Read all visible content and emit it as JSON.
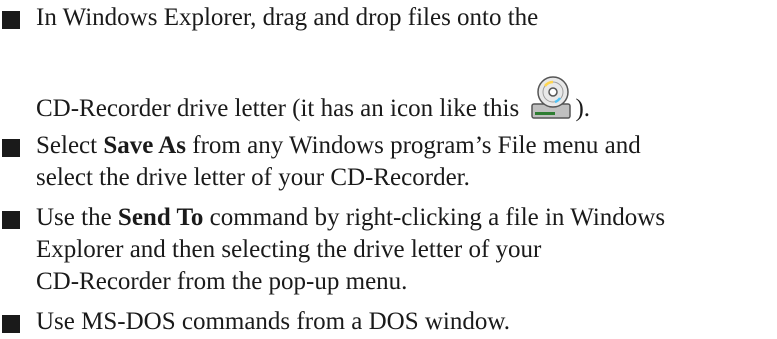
{
  "list": {
    "items": [
      {
        "line1": "In Windows Explorer, drag and drop files onto the",
        "line2_before": "CD-Recorder drive letter (it has an icon like this ",
        "icon": "cd-recorder-drive-icon",
        "line2_after": ")."
      },
      {
        "line1_before": "Select ",
        "bold": "Save As",
        "line1_after": " from any Windows program’s File menu and",
        "line2": "select the drive letter of your CD-Recorder."
      },
      {
        "line1_before": "Use the ",
        "bold": "Send To",
        "line1_after": " command by right-clicking a file in Windows",
        "line2": "Explorer and then selecting the drive letter of your",
        "line3": "CD-Recorder from the pop-up menu."
      },
      {
        "line1": "Use MS-DOS commands from a DOS window."
      }
    ]
  },
  "colors": {
    "text": "#1a1a1a",
    "background": "#ffffff",
    "icon_drive": "#c0c0c0",
    "icon_disc": "#e8e8e8",
    "icon_accent": "#2e7d32"
  }
}
